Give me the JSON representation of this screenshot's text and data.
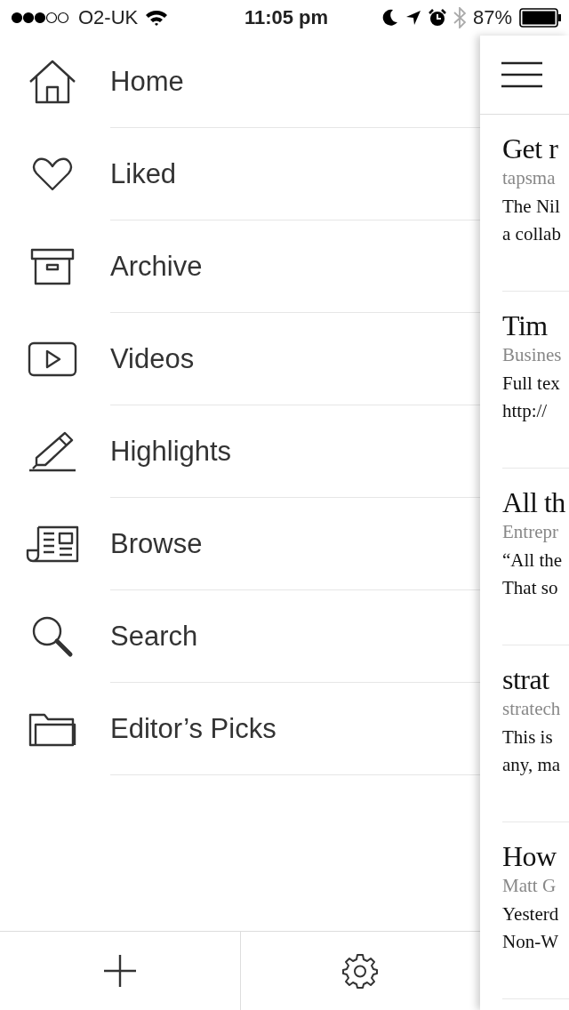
{
  "status_bar": {
    "carrier": "O2-UK",
    "time": "11:05 pm",
    "battery": "87%"
  },
  "menu": [
    {
      "kind": "home",
      "label": "Home"
    },
    {
      "kind": "liked",
      "label": "Liked"
    },
    {
      "kind": "archive",
      "label": "Archive"
    },
    {
      "kind": "videos",
      "label": "Videos"
    },
    {
      "kind": "highlights",
      "label": "Highlights"
    },
    {
      "kind": "browse",
      "label": "Browse"
    },
    {
      "kind": "search",
      "label": "Search"
    },
    {
      "kind": "picks",
      "label": "Editor’s Picks"
    }
  ],
  "articles": [
    {
      "title": "Get r",
      "source": "tapsma",
      "lines": [
        "The Nil",
        "a collab"
      ]
    },
    {
      "title": "Tim",
      "source": "Busines",
      "lines": [
        "Full tex",
        "http://"
      ]
    },
    {
      "title": "All th",
      "source": "Entrepr",
      "lines": [
        "“All the",
        "That so"
      ]
    },
    {
      "title": "strat",
      "source": "stratech",
      "lines": [
        "This is",
        "any, ma"
      ]
    },
    {
      "title": "How",
      "source": "Matt G",
      "lines": [
        "Yesterd",
        "Non-W"
      ]
    }
  ]
}
